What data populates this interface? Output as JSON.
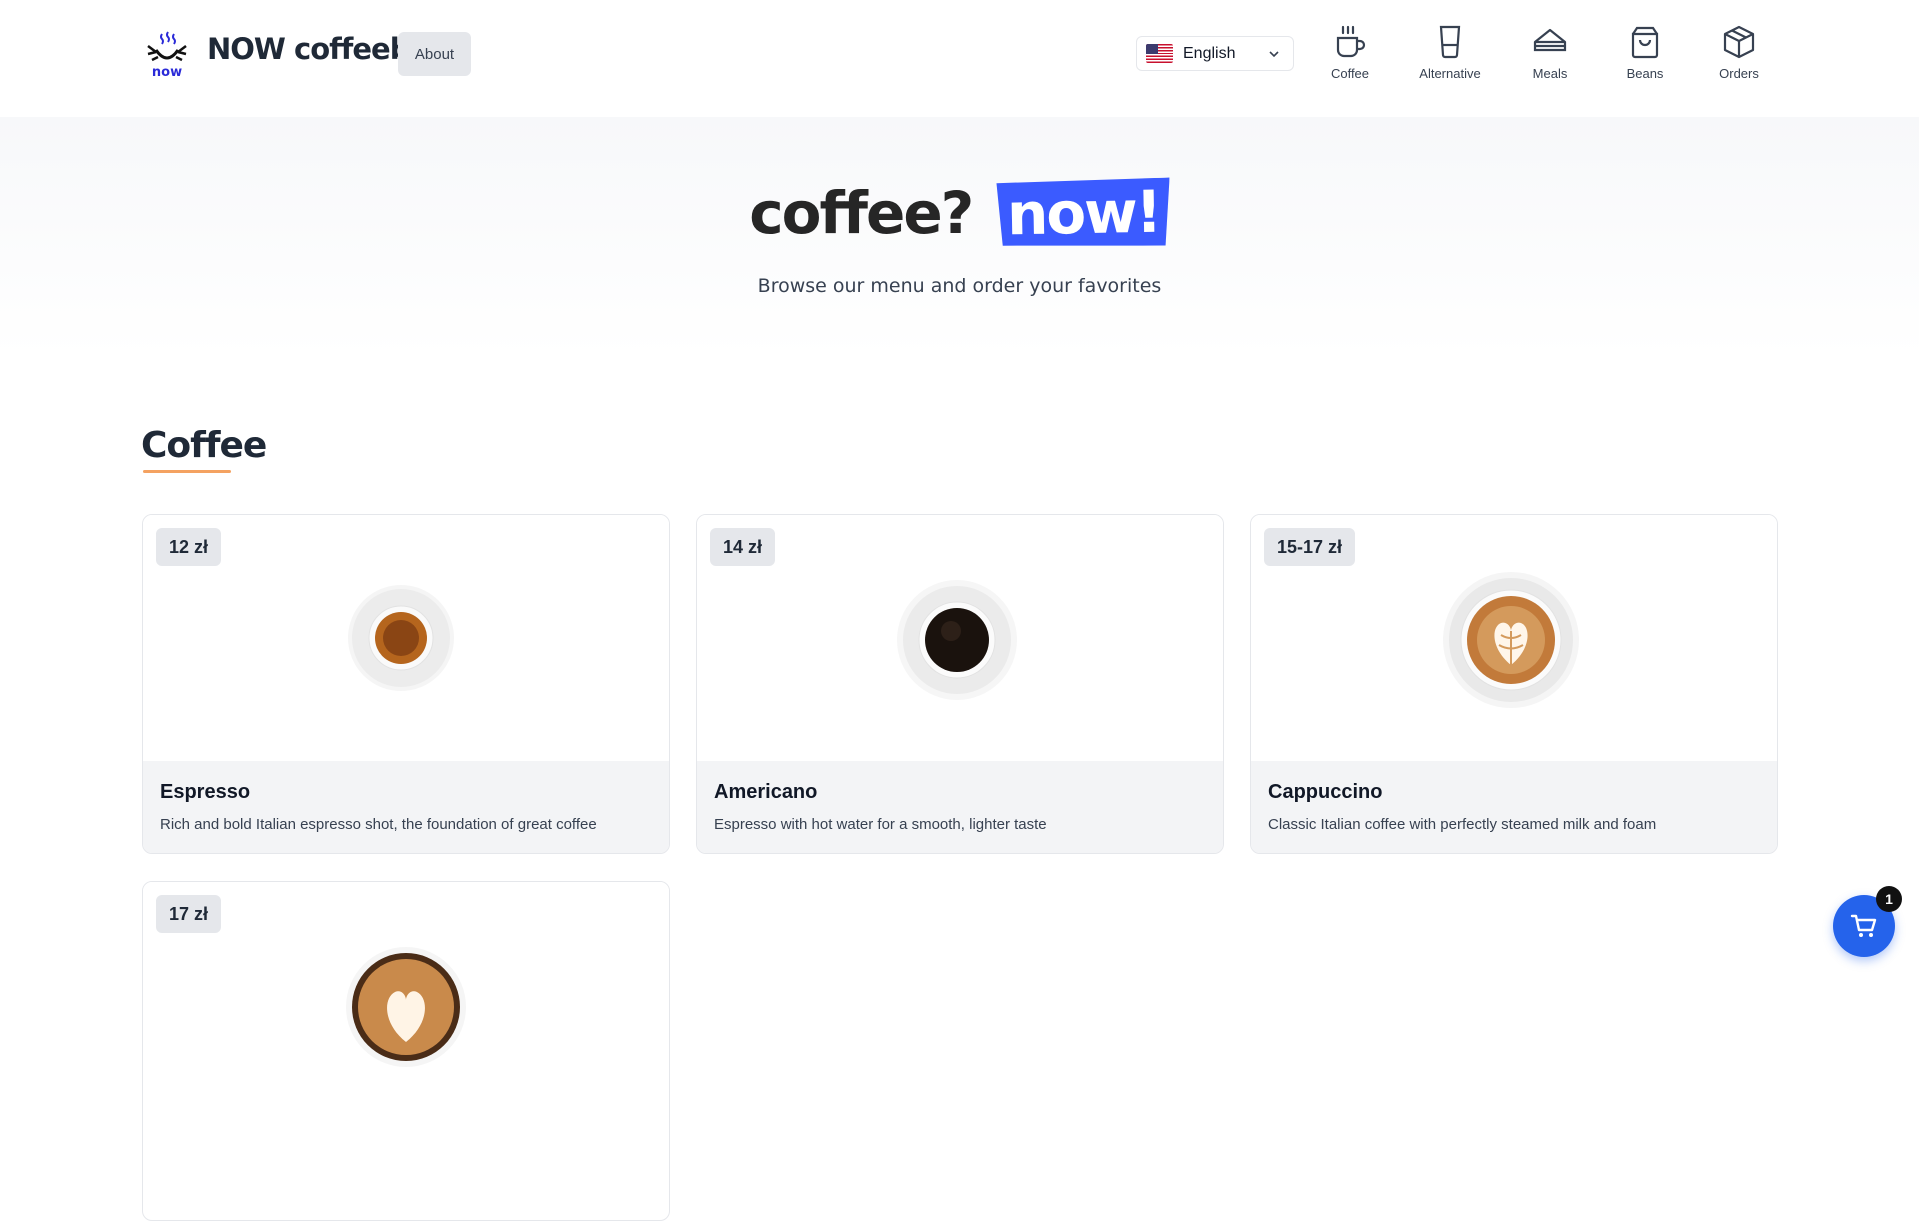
{
  "header": {
    "brand": "NOW coffeebar",
    "logo_text": "now",
    "about_label": "About",
    "language": {
      "selected": "English",
      "flag": "us-flag-icon"
    },
    "nav": [
      {
        "label": "Coffee",
        "icon": "coffee-cup-icon"
      },
      {
        "label": "Alternative",
        "icon": "glass-icon"
      },
      {
        "label": "Meals",
        "icon": "sandwich-icon"
      },
      {
        "label": "Beans",
        "icon": "shopping-bag-icon"
      },
      {
        "label": "Orders",
        "icon": "package-icon"
      }
    ]
  },
  "hero": {
    "title_prefix": "coffee?",
    "title_highlight": "now!",
    "subtitle": "Browse our menu and order your favorites",
    "highlight_color": "#3b5bff"
  },
  "section": {
    "title": "Coffee",
    "underline_color": "#f4a261"
  },
  "products": [
    {
      "price": "12 zł",
      "name": "Espresso",
      "description": "Rich and bold Italian espresso shot, the foundation of great coffee"
    },
    {
      "price": "14 zł",
      "name": "Americano",
      "description": "Espresso with hot water for a smooth, lighter taste"
    },
    {
      "price": "15-17 zł",
      "name": "Cappuccino",
      "description": "Classic Italian coffee with perfectly steamed milk and foam"
    },
    {
      "price": "17 zł",
      "name": "",
      "description": ""
    }
  ],
  "cart": {
    "count": "1",
    "color": "#2563eb",
    "icon": "cart-icon"
  }
}
